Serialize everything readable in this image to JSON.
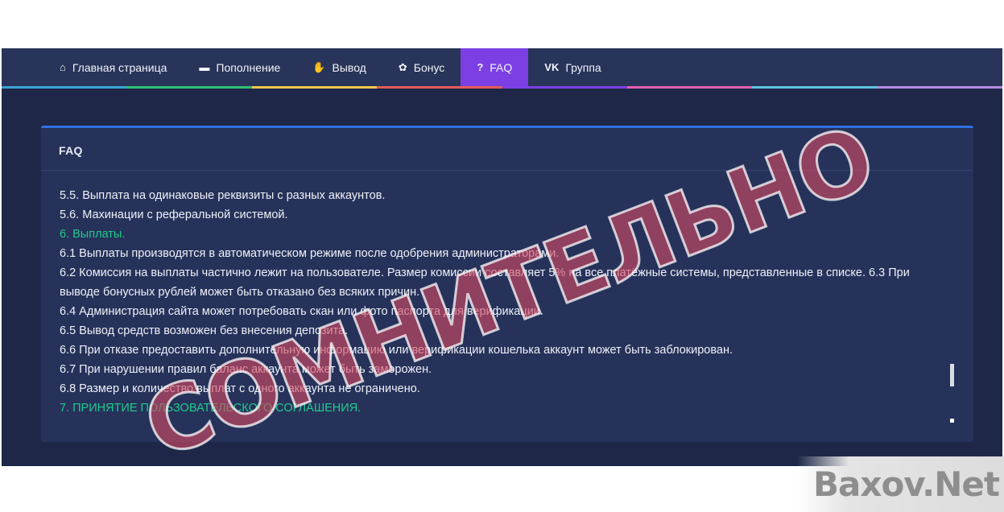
{
  "nav": {
    "items": [
      {
        "label": "Главная страница",
        "icon": "home-icon",
        "glyph": "⌂",
        "active": false
      },
      {
        "label": "Пополнение",
        "icon": "wallet-icon",
        "glyph": "▬",
        "active": false
      },
      {
        "label": "Вывод",
        "icon": "hand-icon",
        "glyph": "✋",
        "active": false
      },
      {
        "label": "Бонус",
        "icon": "gift-icon",
        "glyph": "✿",
        "active": false
      },
      {
        "label": "FAQ",
        "icon": "question-icon",
        "glyph": "?",
        "active": true
      },
      {
        "label": "Группа",
        "icon": "vk-icon",
        "glyph": "VK",
        "active": false
      }
    ],
    "strip_colors": [
      "#3aa3d6",
      "#2fbf71",
      "#f2c94c",
      "#e25b5b",
      "#7b3fe4",
      "#e05fb0",
      "#5fc4e0",
      "#b58be0"
    ]
  },
  "panel": {
    "title": "FAQ",
    "lines": [
      {
        "text": "5.5. Выплата на одинаковые реквизиты с разных аккаунтов.",
        "highlight": false
      },
      {
        "text": "5.6. Махинации с реферальной системой.",
        "highlight": false
      },
      {
        "text": "6. Выплаты.",
        "highlight": true
      },
      {
        "text": "6.1 Выплаты производятся в автоматическом режиме после одобрения администраторами.",
        "highlight": false
      },
      {
        "text": "6.2 Комиссия на выплаты частично лежит на пользователе. Размер комиссии составляет 5% на все платёжные системы, представленные в списке. 6.3 При выводе бонусных рублей может быть отказано без всяких причин.",
        "highlight": false
      },
      {
        "text": "6.4 Администрация сайта может потребовать скан или фото паспорта для верификации.",
        "highlight": false
      },
      {
        "text": "6.5 Вывод средств возможен без внесения депозита.",
        "highlight": false
      },
      {
        "text": "6.6 При отказе предоставить дополнительную информацию или верификации кошелька аккаунт может быть заблокирован.",
        "highlight": false
      },
      {
        "text": "6.7 При нарушении правил баланс аккаунта может быть заморожен.",
        "highlight": false
      },
      {
        "text": "6.8 Размер и количество выплат с одного аккаунта не ограничено.",
        "highlight": false
      },
      {
        "text": "7. ПРИНЯТИЕ ПОЛЬЗОВАТЕЛЬСКОГО СОГЛАШЕНИЯ.",
        "highlight": true
      }
    ]
  },
  "watermark": {
    "text": "СОМНИТЕЛЬНО"
  },
  "logo": {
    "text": "Baxov.Net"
  },
  "colors": {
    "accent": "#7b3fe4",
    "highlight_text": "#1fcc8c",
    "panel_border": "#2f72e4"
  }
}
